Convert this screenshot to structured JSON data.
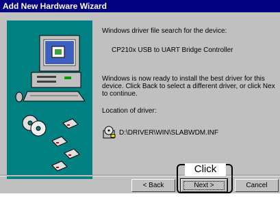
{
  "window": {
    "title": "Add New Hardware Wizard"
  },
  "content": {
    "search_heading": "Windows driver file search for the device:",
    "device_name": "CP210x USB to UART Bridge Controller",
    "ready_lines": [
      "Windows is now ready to install the best driver for this",
      "device. Click Back to select a different driver, or click Nex",
      "to continue."
    ],
    "location_label": "Location of driver:",
    "driver_path": "D:\\DRIVER\\WIN\\SLABWDM.INF"
  },
  "buttons": {
    "back_label": "< Back",
    "next_label": "Next >",
    "cancel_label": "Cancel"
  },
  "annotation": {
    "label": "Click"
  },
  "colors": {
    "title_bar": "#000080",
    "art_background": "#008080",
    "dialog_face": "#c0c0c0"
  }
}
